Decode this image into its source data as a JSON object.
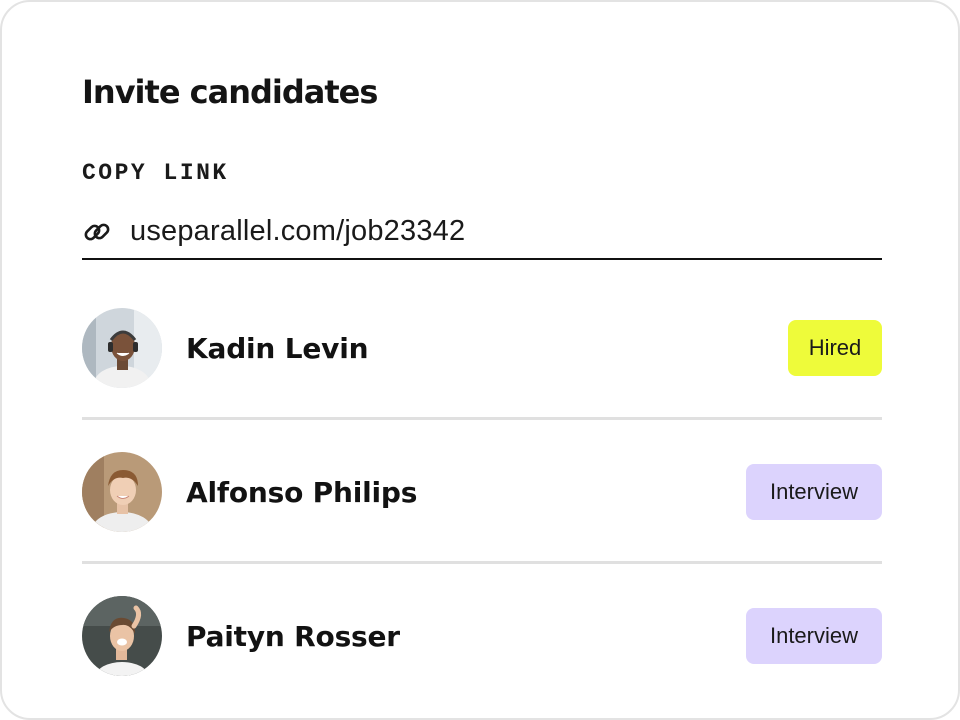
{
  "card": {
    "title": "Invite candidates",
    "copy_link_label": "COPY LINK",
    "link_value": "useparallel.com/job23342",
    "link_icon": "link-icon"
  },
  "candidates": [
    {
      "name": "Kadin Levin",
      "status": "Hired",
      "status_color": "#eefb3a",
      "avatar": "avatar-photo"
    },
    {
      "name": "Alfonso Philips",
      "status": "Interview",
      "status_color": "#dcd3fd",
      "avatar": "avatar-photo"
    },
    {
      "name": "Paityn Rosser",
      "status": "Interview",
      "status_color": "#dcd3fd",
      "avatar": "avatar-photo"
    }
  ],
  "colors": {
    "hired_badge": "#eefb3a",
    "interview_badge": "#dcd3fd",
    "divider": "#e0e0e0",
    "text": "#121212"
  }
}
